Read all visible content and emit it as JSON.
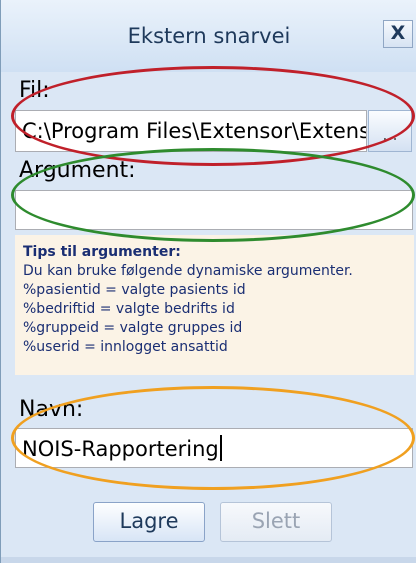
{
  "window": {
    "title": "Ekstern snarvei",
    "close_label": "X"
  },
  "fil": {
    "label": "Fil:",
    "value": "C:\\Program Files\\Extensor\\Extenso",
    "browse_label": "..."
  },
  "argument": {
    "label": "Argument:",
    "value": ""
  },
  "tips": {
    "title": "Tips til argumenter:",
    "lines": [
      "Du kan bruke følgende dynamiske argumenter.",
      "%pasientid = valgte pasients id",
      "%bedriftid = valgte bedrifts id",
      "%gruppeid = valgte gruppes id",
      "%userid = innlogget ansattid"
    ]
  },
  "navn": {
    "label": "Navn:",
    "value": "NOIS-Rapportering"
  },
  "buttons": {
    "save_label": "Lagre",
    "delete_label": "Slett",
    "delete_enabled": false
  },
  "annotations": {
    "fil_ring_color": "#c0202a",
    "argument_ring_color": "#2e8b2e",
    "navn_ring_color": "#f0a020"
  }
}
